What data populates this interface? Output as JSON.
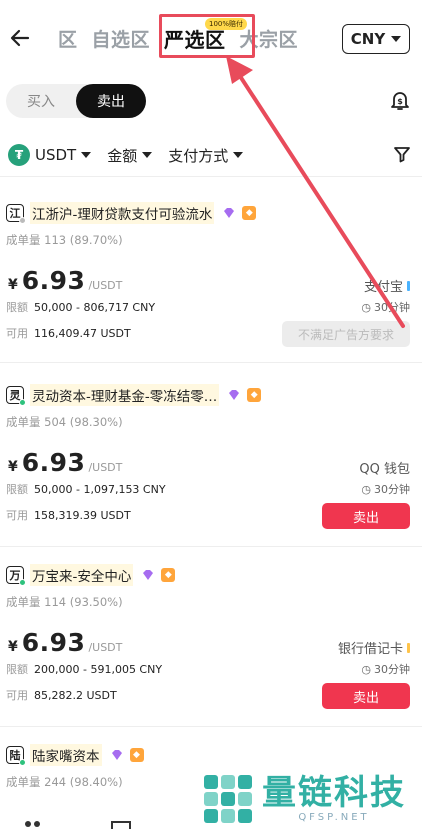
{
  "header": {
    "tabs": [
      {
        "label": "区"
      },
      {
        "label": "自选区"
      },
      {
        "label": "严选区"
      },
      {
        "label": "大宗区"
      }
    ],
    "badge": "100%赔付",
    "currency": "CNY"
  },
  "trade_toggle": {
    "buy": "买入",
    "sell": "卖出"
  },
  "filters": {
    "coin": "USDT",
    "amount": "金额",
    "payment": "支付方式"
  },
  "listings": [
    {
      "avatar": "江",
      "name": "江浙沪-理财贷款支付可验流水",
      "volume_label": "成单量",
      "volume": "113 (89.70%)",
      "currency_symbol": "¥",
      "price": "6.93",
      "price_unit": "/USDT",
      "limit_label": "限额",
      "limit": "50,000 - 806,717 CNY",
      "avail_label": "可用",
      "available": "116,409.47 USDT",
      "payment": "支付宝",
      "time": "30分钟",
      "action": "不满足广告方要求"
    },
    {
      "avatar": "灵",
      "name": "灵动资本-理财基金-零冻结零…",
      "volume_label": "成单量",
      "volume": "504 (98.30%)",
      "currency_symbol": "¥",
      "price": "6.93",
      "price_unit": "/USDT",
      "limit_label": "限额",
      "limit": "50,000 - 1,097,153 CNY",
      "avail_label": "可用",
      "available": "158,319.39 USDT",
      "payment": "QQ 钱包",
      "time": "30分钟",
      "action": "卖出"
    },
    {
      "avatar": "万",
      "name": "万宝来-安全中心",
      "volume_label": "成单量",
      "volume": "114 (93.50%)",
      "currency_symbol": "¥",
      "price": "6.93",
      "price_unit": "/USDT",
      "limit_label": "限额",
      "limit": "200,000 - 591,005 CNY",
      "avail_label": "可用",
      "available": "85,282.2 USDT",
      "payment": "银行借记卡",
      "time": "30分钟",
      "action": "卖出"
    },
    {
      "avatar": "陆",
      "name": "陆家嘴资本",
      "volume_label": "成单量",
      "volume": "244 (98.40%)"
    }
  ],
  "watermark": {
    "text": "量链科技",
    "url": "QFSP.NET"
  },
  "colors": {
    "sell": "#f0364f",
    "highlight": "#e84b5b",
    "usdt": "#26a17b",
    "watermark": "#32b0a4"
  }
}
